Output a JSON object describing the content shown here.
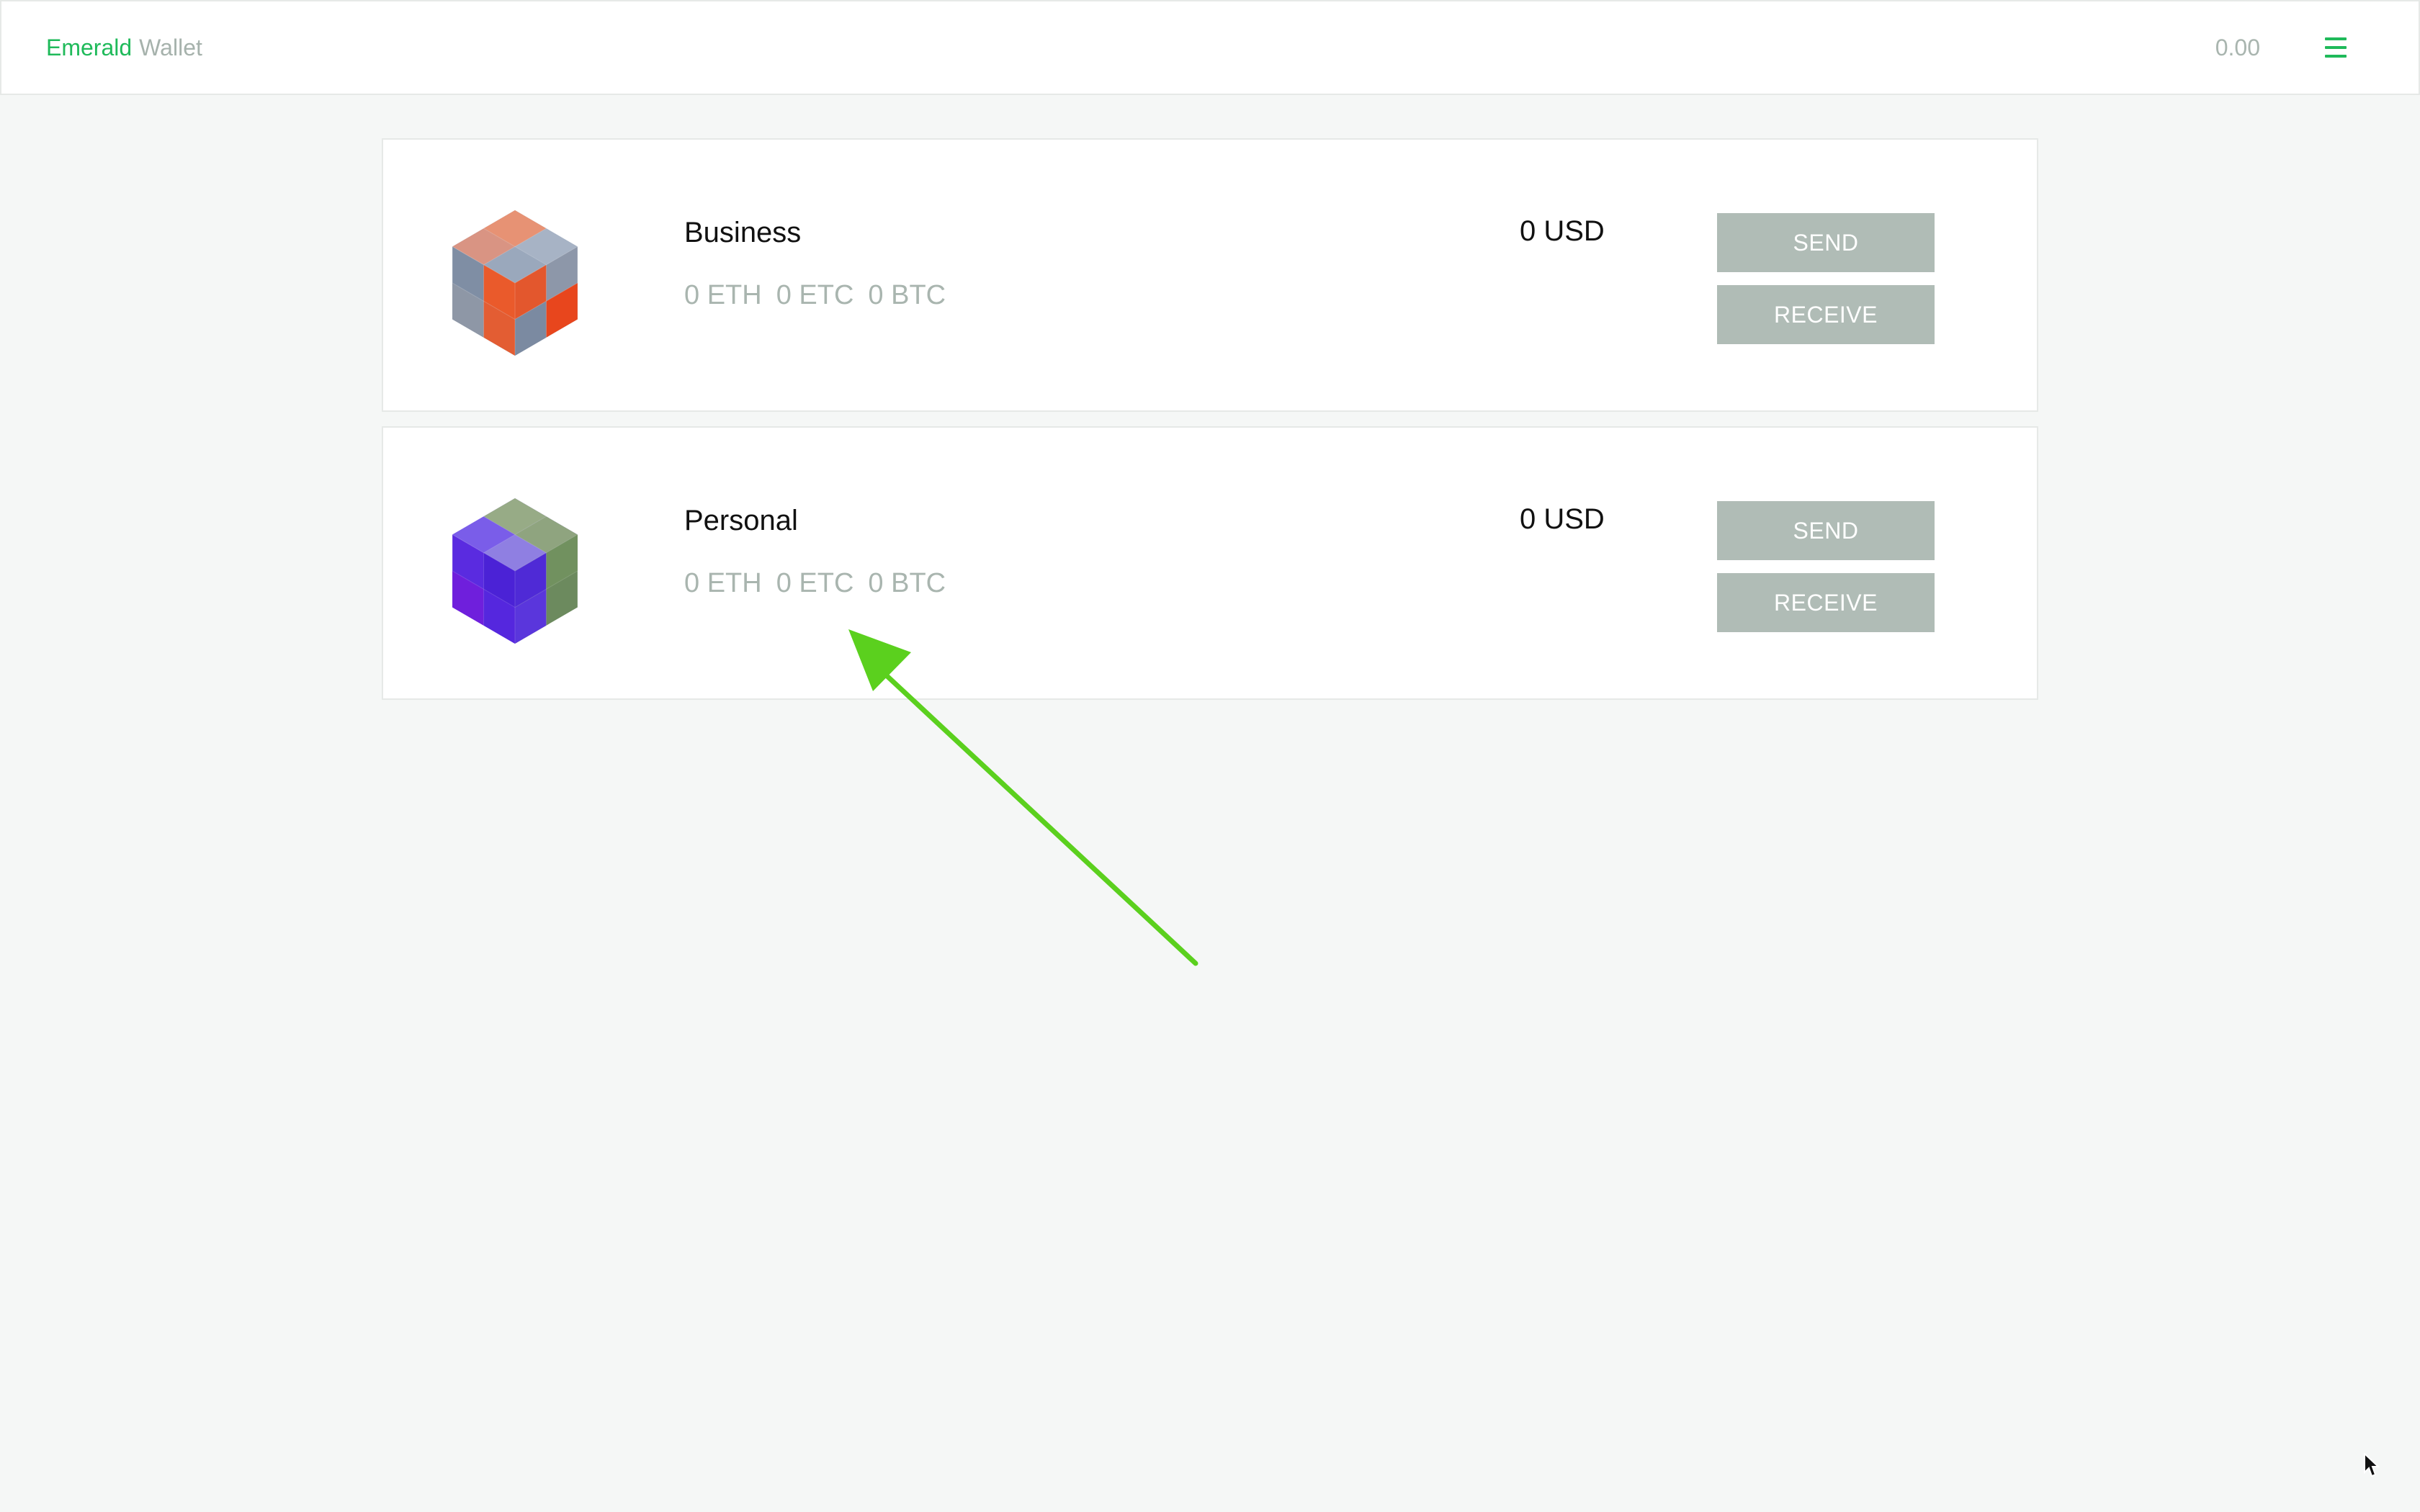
{
  "app": {
    "brand_primary": "Emerald",
    "brand_secondary": "Wallet",
    "header_balance": "0.00",
    "menu_icon": "hamburger-menu-icon"
  },
  "colors": {
    "accent": "#1fba5a",
    "muted_text": "#a9b5af",
    "button_bg": "#b0bcb6",
    "card_bg": "#ffffff",
    "page_bg": "#f5f7f6",
    "annotation_arrow": "#5bd01e"
  },
  "accounts": [
    {
      "name": "Business",
      "balances": [
        "0 ETH",
        "0 ETC",
        "0 BTC"
      ],
      "fiat_total": "0 USD",
      "send_label": "SEND",
      "receive_label": "RECEIVE",
      "identicon": "orange-slate-cube-identicon"
    },
    {
      "name": "Personal",
      "balances": [
        "0 ETH",
        "0 ETC",
        "0 BTC"
      ],
      "fiat_total": "0 USD",
      "send_label": "SEND",
      "receive_label": "RECEIVE",
      "identicon": "purple-green-cube-identicon"
    }
  ]
}
